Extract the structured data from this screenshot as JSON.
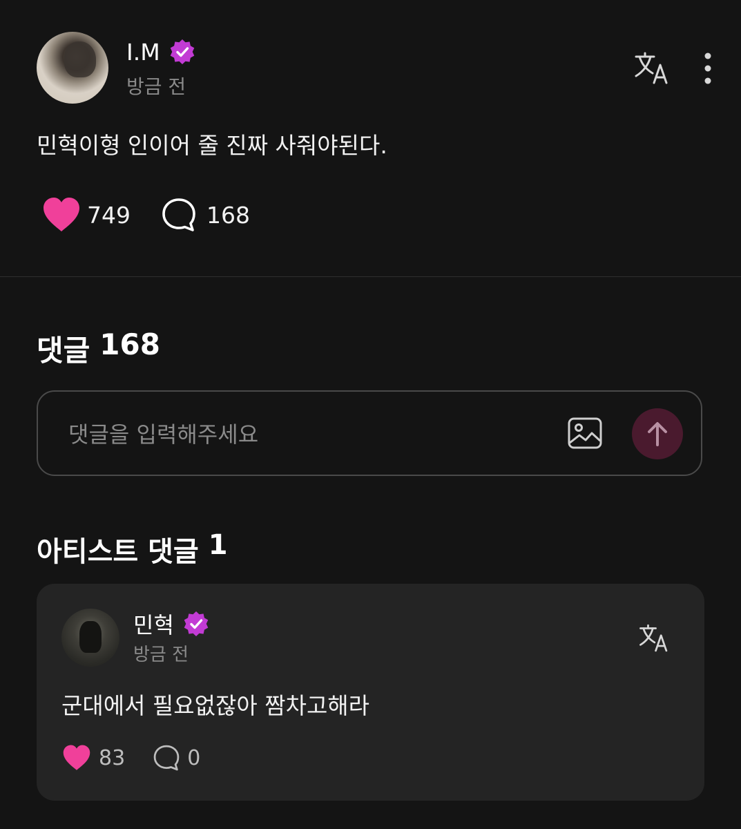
{
  "post": {
    "author": "I.M",
    "time": "방금 전",
    "text": "민혁이형 인이어 줄 진짜 사줘야된다.",
    "likes": "749",
    "comments": "168"
  },
  "comments_section": {
    "title": "댓글",
    "count": "168",
    "input_placeholder": "댓글을 입력해주세요"
  },
  "artist_comments": {
    "title": "아티스트 댓글",
    "count": "1",
    "items": [
      {
        "author": "민혁",
        "time": "방금 전",
        "text": "군대에서 필요없잖아 짬차고해라",
        "likes": "83",
        "replies": "0"
      }
    ]
  },
  "colors": {
    "background": "#141414",
    "card": "#242424",
    "heart": "#f0409a",
    "verified_badge": "#c23bd4",
    "send_button": "#4a1a2e",
    "muted_text": "#8a8a8a"
  },
  "icons": [
    "verified-badge-icon",
    "translate-icon",
    "more-options-icon",
    "heart-icon",
    "comment-bubble-icon",
    "image-upload-icon",
    "arrow-up-icon"
  ]
}
